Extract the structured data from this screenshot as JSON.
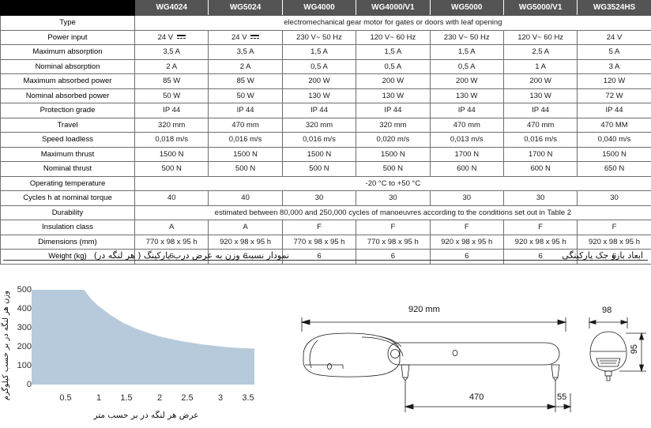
{
  "table": {
    "models": [
      "WG4024",
      "WG5024",
      "WG4000",
      "WG4000/V1",
      "WG5000",
      "WG5000/V1",
      "WG3524HS"
    ],
    "rows": [
      {
        "label": "Type",
        "span": true,
        "align": "center",
        "value": "electromechanical gear motor for gates or doors with leaf opening"
      },
      {
        "label": "Power input",
        "values": [
          "24 V ⎓",
          "24 V ⎓",
          "230 V~  50 Hz",
          "120 V~  60 Hz",
          "230 V~  50 Hz",
          "120 V~  60 Hz",
          "24 V"
        ]
      },
      {
        "label": "Maximum absorption",
        "values": [
          "3,5 A",
          "3,5 A",
          "1,5 A",
          "1,5 A",
          "1,5 A",
          "2,5 A",
          "5 A"
        ]
      },
      {
        "label": "Nominal absorption",
        "values": [
          "2 A",
          "2 A",
          "0,5 A",
          "0,5 A",
          "0,5 A",
          "1 A",
          "3 A"
        ]
      },
      {
        "label": "Maximum absorbed power",
        "values": [
          "85 W",
          "85 W",
          "200 W",
          "200 W",
          "200 W",
          "200 W",
          "120 W"
        ]
      },
      {
        "label": "Nominal absorbed power",
        "values": [
          "50 W",
          "50 W",
          "130 W",
          "130 W",
          "130 W",
          "130 W",
          "72 W"
        ]
      },
      {
        "label": "Protection grade",
        "values": [
          "IP 44",
          "IP 44",
          "IP 44",
          "IP 44",
          "IP 44",
          "IP 44",
          "IP 44"
        ]
      },
      {
        "label": "Travel",
        "values": [
          "320 mm",
          "470 mm",
          "320 mm",
          "320 mm",
          "470 mm",
          "470 mm",
          "470 MM"
        ]
      },
      {
        "label": "Speed loadless",
        "values": [
          "0,018 m/s",
          "0,016 m/s",
          "0,016 m/s",
          "0,020 m/s",
          "0,013 m/s",
          "0,016 m/s",
          "0,040 m/s"
        ]
      },
      {
        "label": "Maximum thrust",
        "values": [
          "1500 N",
          "1500 N",
          "1500 N",
          "1500 N",
          "1700 N",
          "1700 N",
          "1500 N"
        ]
      },
      {
        "label": "Nominal thrust",
        "values": [
          "500 N",
          "500 N",
          "500 N",
          "500 N",
          "600 N",
          "600 N",
          "650 N"
        ]
      },
      {
        "label": "Operating temperature",
        "span": true,
        "align": "center",
        "value": "-20 °C to +50 °C"
      },
      {
        "label": "Cycles h at nominal torque",
        "values": [
          "40",
          "40",
          "30",
          "30",
          "30",
          "30",
          "30"
        ]
      },
      {
        "label": "Durability",
        "span": true,
        "align": "center",
        "value": "estimated between 80,000 and 250,000 cycles of manoeuvres according to the conditions set out in Table 2"
      },
      {
        "label": "Insulation class",
        "values": [
          "A",
          "A",
          "F",
          "F",
          "F",
          "F",
          "F"
        ]
      },
      {
        "label": "Dimensions (mm)",
        "values": [
          "770 x 98 x 95 h",
          "920 x 98 x 95 h",
          "770 x 98 x 95 h",
          "770 x 98 x 95 h",
          "920 x 98 x 95 h",
          "920 x 98 x 95 h",
          "920 x 98 x 95 h"
        ]
      },
      {
        "label": "Weight (kg)",
        "values": [
          "6",
          "6",
          "6",
          "6",
          "6",
          "6",
          "6"
        ]
      }
    ]
  },
  "left_panel": {
    "title": "نمودار نسبت وزن به عرض درب پارکینگ ( هر لنگه در)"
  },
  "right_panel": {
    "title": "ابعاد بازو جک پارکینگی",
    "dimensions": {
      "total_length": "920 mm",
      "bracket_span": "470",
      "end_offset": "55",
      "width": "98",
      "height": "95"
    }
  },
  "chart_data": {
    "type": "area",
    "title": "نمودار نسبت وزن به عرض درب پارکینگ ( هر لنگه در)",
    "xlabel": "عرض هر لنگه در بر حسب متر",
    "ylabel": "وزن هر لنگه در بر حسب کیلوگرم",
    "xlim": [
      0.2,
      3.6
    ],
    "ylim": [
      0,
      500
    ],
    "yticks": [
      0,
      100,
      200,
      300,
      400,
      500
    ],
    "xticks": [
      0.5,
      1,
      1.5,
      2,
      2.5,
      3,
      3.5
    ],
    "xtick_labels": [
      "0.5",
      "1",
      "1.5",
      "2",
      "2.5",
      "3",
      "3.5"
    ],
    "ytick_labels": [
      "0",
      "100",
      "200",
      "300",
      "400",
      "500"
    ],
    "grid": false,
    "legend": "none",
    "fill_color": "#b7cadb",
    "x": [
      0.2,
      0.5,
      0.8,
      1.0,
      1.1,
      1.2,
      1.4,
      1.6,
      1.8,
      2.0,
      2.2,
      2.5,
      2.8,
      3.0,
      3.2,
      3.4,
      3.6
    ],
    "y": [
      500,
      500,
      500,
      500,
      455,
      420,
      368,
      325,
      295,
      270,
      250,
      228,
      212,
      204,
      197,
      192,
      190
    ]
  }
}
